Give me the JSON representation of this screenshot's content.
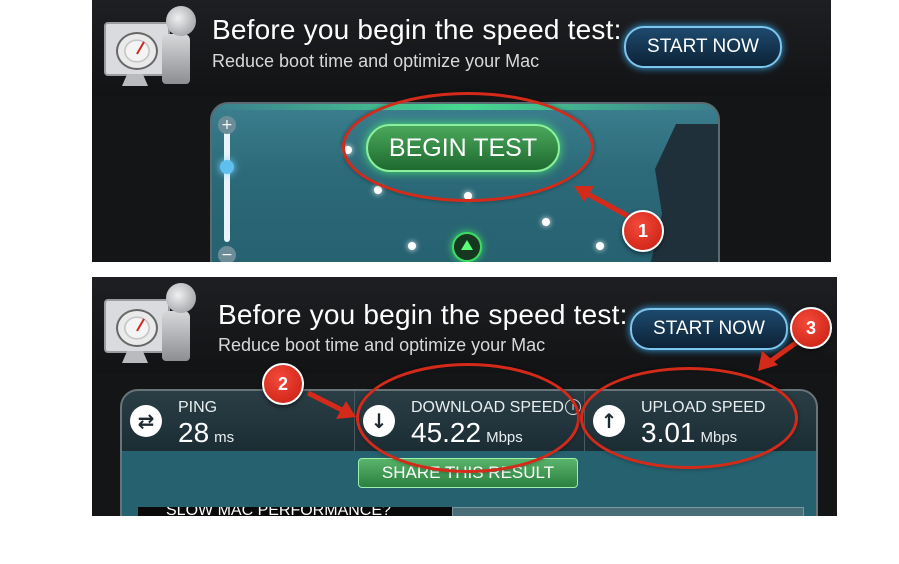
{
  "promo": {
    "title": "Before you begin the speed test:",
    "subtitle": "Reduce boot time and optimize your Mac",
    "start_label": "START NOW"
  },
  "test": {
    "begin_label": "BEGIN TEST"
  },
  "results": {
    "ping": {
      "label": "PING",
      "value": "28",
      "unit": "ms",
      "icon": "swap-arrows-icon"
    },
    "download": {
      "label": "DOWNLOAD SPEED",
      "value": "45.22",
      "unit": "Mbps",
      "icon": "arrow-down-icon",
      "info": "i"
    },
    "upload": {
      "label": "UPLOAD SPEED",
      "value": "3.01",
      "unit": "Mbps",
      "icon": "arrow-up-icon"
    },
    "share_label": "SHARE THIS RESULT"
  },
  "ad": {
    "label": "SLOW MAC PERFORMANCE?"
  },
  "map": {
    "zoom_in": "+",
    "zoom_out": "−"
  },
  "steps": [
    "1",
    "2",
    "3"
  ],
  "colors": {
    "annotation_red": "#d42a1a",
    "accent_green": "#48e070",
    "accent_blue": "#3aa6e6"
  }
}
